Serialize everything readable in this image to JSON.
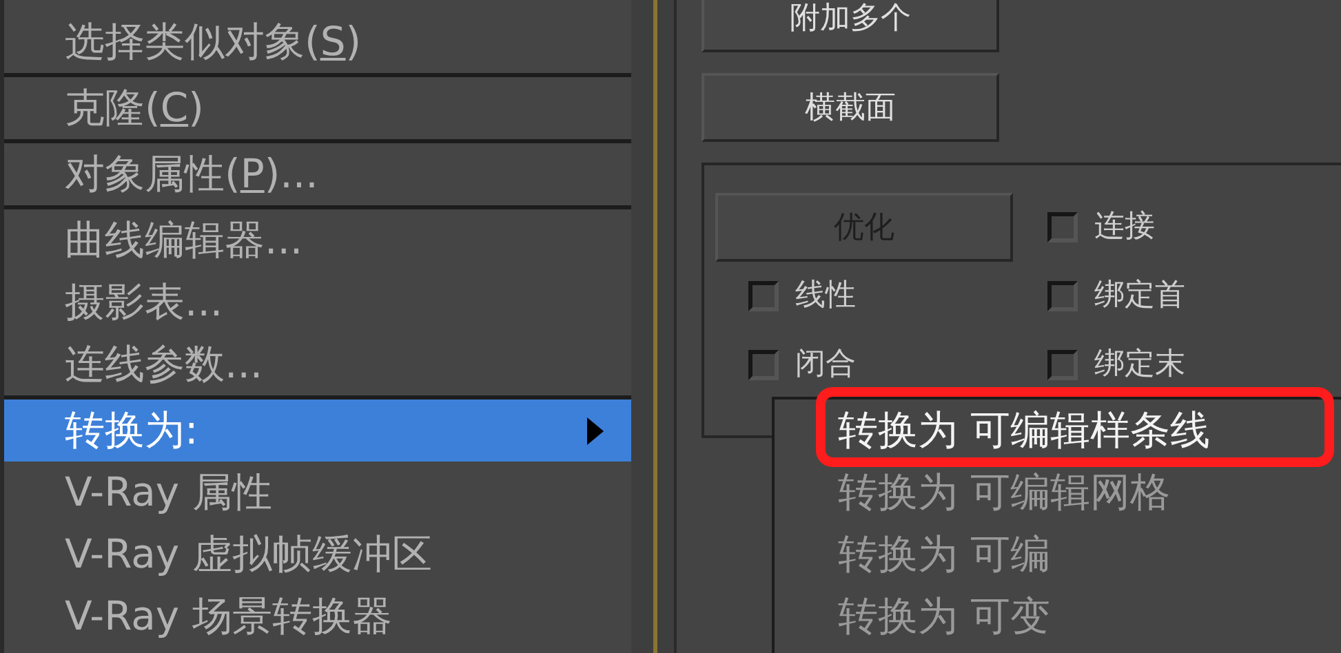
{
  "context_menu": {
    "items": [
      {
        "label": "选择类似对象(S)",
        "mnemonic_underlined": true,
        "separator_after": true,
        "selected": false
      },
      {
        "label": "克隆(C)",
        "mnemonic_underlined": true,
        "separator_after": true,
        "selected": false
      },
      {
        "label": "对象属性(P)...",
        "mnemonic_underlined": true,
        "separator_after": true,
        "selected": false
      },
      {
        "label": "曲线编辑器...",
        "separator_after": false,
        "selected": false
      },
      {
        "label": "摄影表...",
        "separator_after": false,
        "selected": false
      },
      {
        "label": "连线参数...",
        "separator_after": true,
        "selected": false
      },
      {
        "label": "转换为:",
        "submenu": true,
        "separator_after": false,
        "selected": true
      },
      {
        "label": "V-Ray 属性",
        "separator_after": false,
        "selected": false
      },
      {
        "label": "V-Ray 虚拟帧缓冲区",
        "separator_after": false,
        "selected": false
      },
      {
        "label": "V-Ray 场景转换器",
        "separator_after": false,
        "selected": false
      }
    ]
  },
  "submenu": {
    "items": [
      {
        "label": "转换为 可编辑样条线",
        "selected": true,
        "highlighted": true
      },
      {
        "label": "转换为 可编辑网格",
        "selected": false,
        "highlighted": false
      },
      {
        "label": "转换为 可编",
        "selected": false,
        "highlighted": false
      },
      {
        "label": "转换为 可变",
        "selected": false,
        "highlighted": false
      }
    ]
  },
  "panel": {
    "buttons": [
      {
        "label": "附加多个",
        "disabled": false
      },
      {
        "label": "横截面",
        "disabled": false
      }
    ],
    "group": {
      "button": {
        "label": "优化",
        "disabled": true
      },
      "checkboxes": [
        {
          "label": "连接",
          "checked": false
        },
        {
          "label": "线性",
          "checked": false
        },
        {
          "label": "绑定首",
          "checked": false
        },
        {
          "label": "闭合",
          "checked": false
        },
        {
          "label": "绑定末",
          "checked": false
        }
      ]
    }
  }
}
